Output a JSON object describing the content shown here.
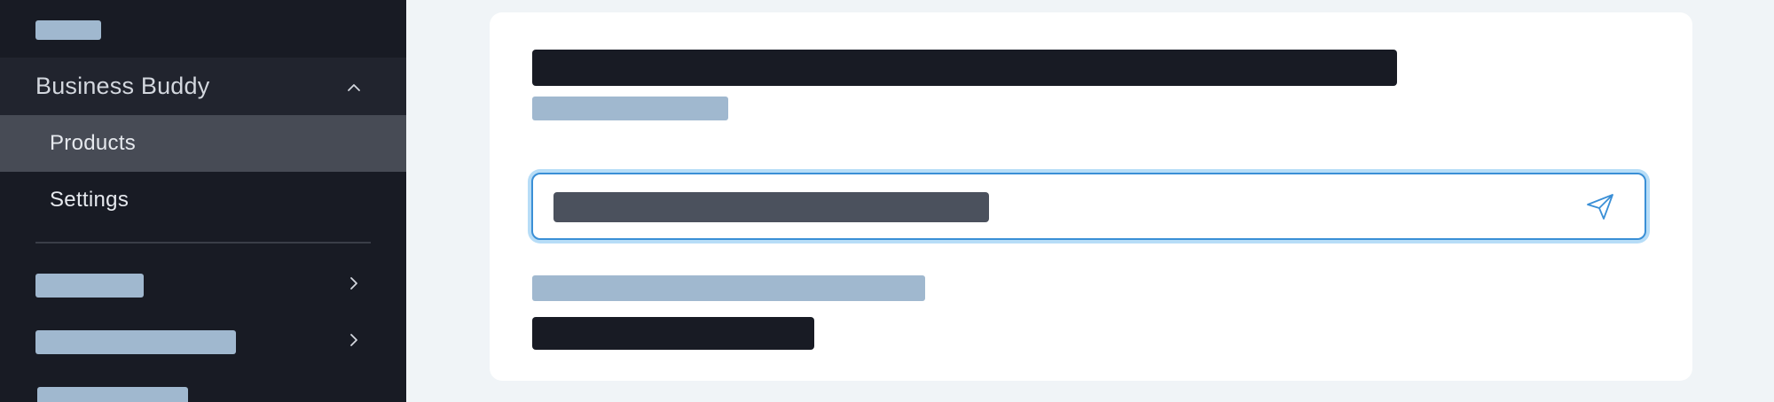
{
  "sidebar": {
    "section": {
      "title": "Business Buddy",
      "expanded": true,
      "chevron_icon": "chevron-up-icon"
    },
    "items": [
      {
        "label": "Products",
        "active": true
      },
      {
        "label": "Settings",
        "active": false
      }
    ],
    "more_items_icon": "chevron-right-icon"
  },
  "main": {
    "input": {
      "send_icon": "send-icon"
    }
  },
  "colors": {
    "sidebar_bg": "#181b24",
    "section_header_bg": "#21242e",
    "active_item_bg": "#474b55",
    "page_bg": "#f0f4f7",
    "card_bg": "#ffffff",
    "skeleton_light": "#a0b8cf",
    "skeleton_dark": "#181b24",
    "input_border": "#3a8fd6",
    "input_focus_ring": "#b7ddf7"
  }
}
